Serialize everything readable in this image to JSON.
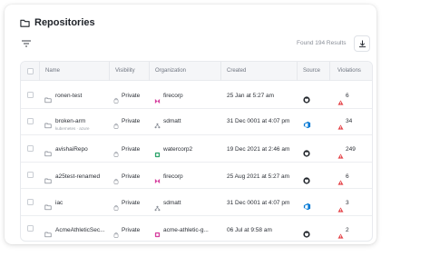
{
  "header": {
    "title": "Repositories"
  },
  "toolbar": {
    "results_text": "Found 194 Results"
  },
  "table": {
    "columns": [
      "Name",
      "Visibility",
      "Organization",
      "Created",
      "Source",
      "Violations"
    ],
    "rows": [
      {
        "name": "ronen-test",
        "sub": "",
        "visibility": "Private",
        "org": "firecorp",
        "org_icon": "firecorp-icon",
        "created": "25 Jan at 5:27 am",
        "source": "github-icon",
        "violations": "6"
      },
      {
        "name": "broken-arm",
        "sub": "kubernetes · azure",
        "visibility": "Private",
        "org": "sdmatt",
        "org_icon": "azure-org-icon",
        "created": "31 Dec 0001 at 4:07 pm",
        "source": "azure-devops-icon",
        "violations": "34"
      },
      {
        "name": "avishaiRepo",
        "sub": "",
        "visibility": "Private",
        "org": "watercorp2",
        "org_icon": "watercorp-icon",
        "created": "19 Dec 2021 at 2:46 am",
        "source": "github-icon",
        "violations": "249"
      },
      {
        "name": "a25test-renamed",
        "sub": "",
        "visibility": "Private",
        "org": "firecorp",
        "org_icon": "firecorp-icon",
        "created": "25 Aug 2021 at 5:27 am",
        "source": "github-icon",
        "violations": "6"
      },
      {
        "name": "iac",
        "sub": "",
        "visibility": "Private",
        "org": "sdmatt",
        "org_icon": "azure-org-icon",
        "created": "31 Dec 0001 at 4:07 pm",
        "source": "azure-devops-icon",
        "violations": "3"
      },
      {
        "name": "AcmeAthleticSec...",
        "sub": "",
        "visibility": "Private",
        "org": "acme-athletic-g...",
        "org_icon": "acme-org-icon",
        "created": "06 Jul at 9:58 am",
        "source": "github-icon",
        "violations": "2"
      }
    ]
  },
  "colors": {
    "violation": "#e5484d",
    "firecorp": "#d6409f",
    "watercorp": "#30a46c",
    "azure": "#0078d4",
    "github": "#1f2329"
  }
}
